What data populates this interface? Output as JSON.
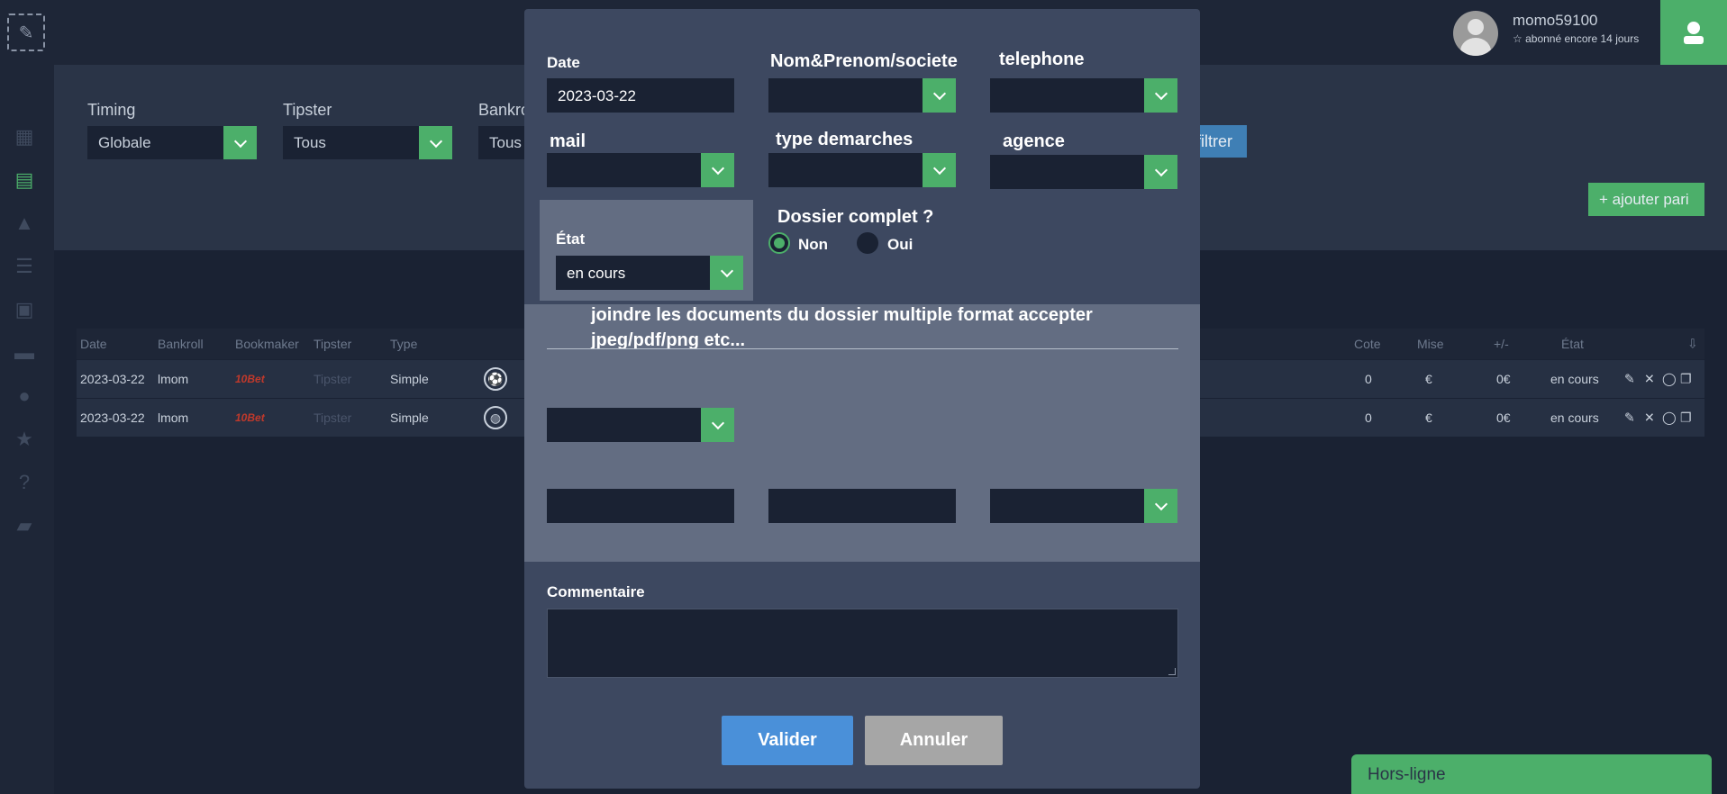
{
  "topbar": {
    "username": "momo59100",
    "subscription": "abonné encore 14 jours"
  },
  "filters": {
    "timing_label": "Timing",
    "timing_value": "Globale",
    "tipster_label": "Tipster",
    "tipster_value": "Tous",
    "bankroll_label": "Bankro",
    "bankroll_value": "Tous",
    "filter_button": "filtrer",
    "add_button": "+ ajouter pari"
  },
  "table": {
    "headers": [
      "Date",
      "Bankroll",
      "Bookmaker",
      "Tipster",
      "Type",
      "Cote",
      "Mise",
      "+/-",
      "État"
    ],
    "rows": [
      {
        "date": "2023-03-22",
        "bankroll": "lmom",
        "bookmaker": "10Bet",
        "tipster": "Tipster",
        "type": "Simple",
        "cote": "0",
        "mise": "€",
        "pl": "0€",
        "etat": "en cours"
      },
      {
        "date": "2023-03-22",
        "bankroll": "lmom",
        "bookmaker": "10Bet",
        "tipster": "Tipster",
        "type": "Simple",
        "cote": "0",
        "mise": "€",
        "pl": "0€",
        "etat": "en cours"
      }
    ]
  },
  "modal": {
    "date_label": "Date",
    "date_value": "2023-03-22",
    "name_label": "Nom&Prenom/societe",
    "phone_label": "telephone",
    "mail_label": "mail",
    "demarches_label": "type demarches",
    "agence_label": "agence",
    "etat_label": "État",
    "etat_value": "en cours",
    "dossier_label": "Dossier complet ?",
    "radio_non": "Non",
    "radio_oui": "Oui",
    "join_text": "joindre les documents du dossier multiple format accepter jpeg/pdf/png etc...",
    "comment_label": "Commentaire",
    "valider": "Valider",
    "annuler": "Annuler"
  },
  "status_bar": {
    "label": "Hors-ligne"
  },
  "colors": {
    "accent_green": "#4caf6a",
    "accent_blue": "#4a90d9",
    "background": "#1a2233"
  }
}
